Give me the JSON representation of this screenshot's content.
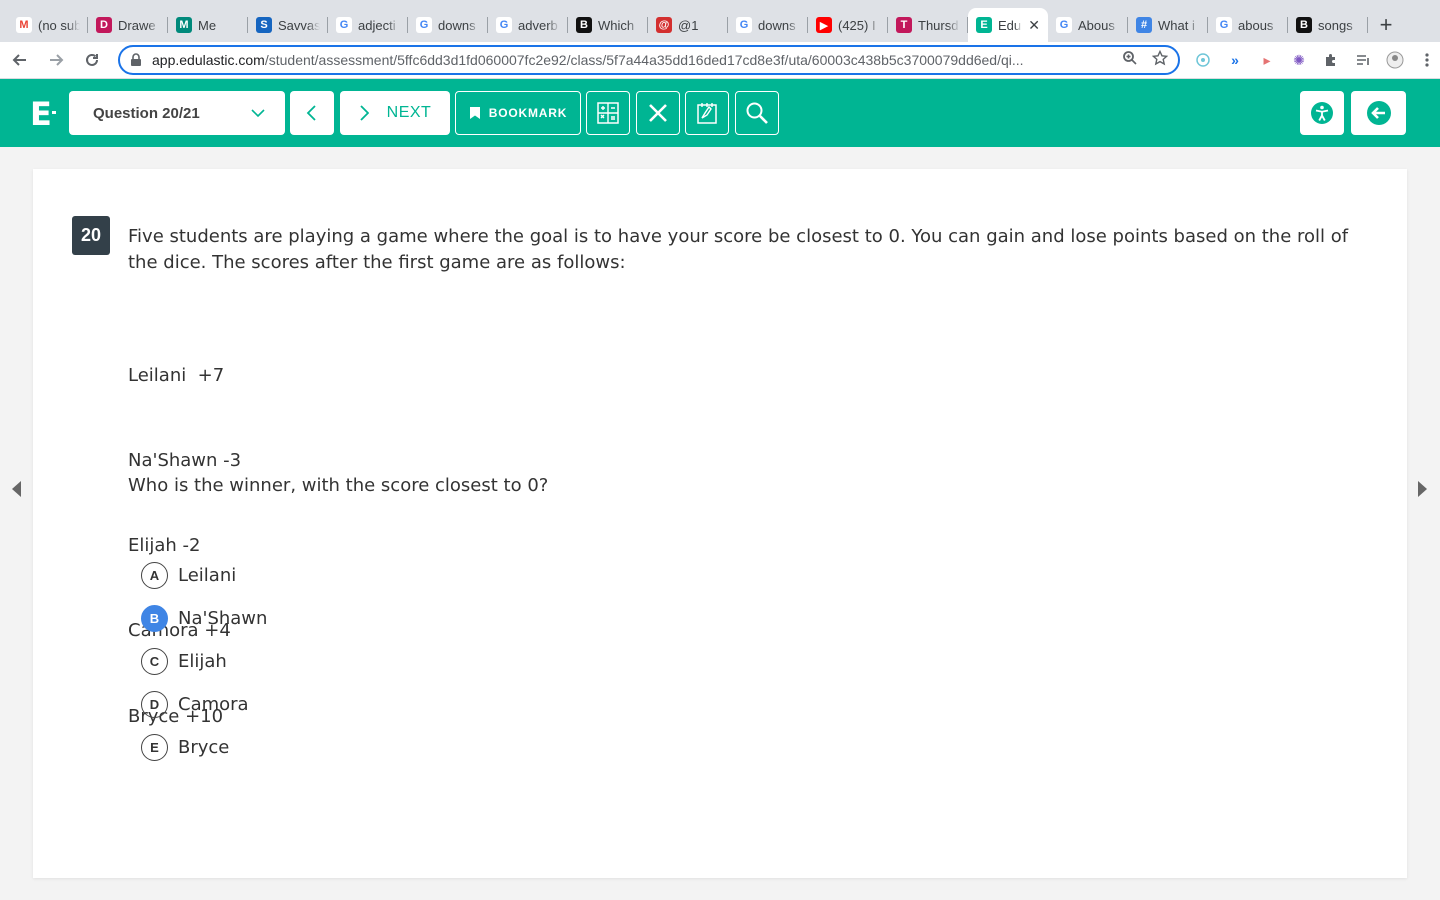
{
  "browser": {
    "tabs": [
      {
        "title": "(no sub",
        "fav_color": "#ffffff",
        "fav_glyph": "M",
        "fav_text_color": "#ea4335"
      },
      {
        "title": "Drawe",
        "fav_color": "#c2185b",
        "fav_glyph": "D",
        "fav_text_color": "#ffffff"
      },
      {
        "title": "Me",
        "fav_color": "#00897b",
        "fav_glyph": "M",
        "fav_text_color": "#ffffff"
      },
      {
        "title": "Savvas",
        "fav_color": "#1565c0",
        "fav_glyph": "S",
        "fav_text_color": "#ffffff"
      },
      {
        "title": "adjecti",
        "fav_color": "#ffffff",
        "fav_glyph": "G",
        "fav_text_color": "#4285f4"
      },
      {
        "title": "downs",
        "fav_color": "#ffffff",
        "fav_glyph": "G",
        "fav_text_color": "#4285f4"
      },
      {
        "title": "adverb",
        "fav_color": "#ffffff",
        "fav_glyph": "G",
        "fav_text_color": "#4285f4"
      },
      {
        "title": "Which",
        "fav_color": "#111111",
        "fav_glyph": "B",
        "fav_text_color": "#ffffff"
      },
      {
        "title": "@1",
        "fav_color": "#d32f2f",
        "fav_glyph": "@",
        "fav_text_color": "#ffffff"
      },
      {
        "title": "downs",
        "fav_color": "#ffffff",
        "fav_glyph": "G",
        "fav_text_color": "#4285f4"
      },
      {
        "title": "(425) I",
        "fav_color": "#ff0000",
        "fav_glyph": "▶",
        "fav_text_color": "#ffffff"
      },
      {
        "title": "Thursd",
        "fav_color": "#c2185b",
        "fav_glyph": "T",
        "fav_text_color": "#ffffff"
      },
      {
        "title": "Edu",
        "fav_color": "#00b593",
        "fav_glyph": "E",
        "fav_text_color": "#ffffff",
        "active": true
      },
      {
        "title": "Abous",
        "fav_color": "#ffffff",
        "fav_glyph": "G",
        "fav_text_color": "#4285f4"
      },
      {
        "title": "What i",
        "fav_color": "#3f85e5",
        "fav_glyph": "#",
        "fav_text_color": "#ffffff"
      },
      {
        "title": "abous",
        "fav_color": "#ffffff",
        "fav_glyph": "G",
        "fav_text_color": "#4285f4"
      },
      {
        "title": "songs",
        "fav_color": "#111111",
        "fav_glyph": "B",
        "fav_text_color": "#ffffff"
      }
    ],
    "new_tab_glyph": "+",
    "url_host": "app.edulastic.com",
    "url_path": "/student/assessment/5ffc6dd3d1fd060007fc2e92/class/5f7a44a35dd16ded17cd8e3f/uta/60003c438b5c3700079dd6ed/qi..."
  },
  "header": {
    "logo": "E",
    "question_select": "Question 20/21",
    "next_label": "NEXT",
    "bookmark_label": "BOOKMARK"
  },
  "question": {
    "number": "20",
    "stem": "Five students are playing a game where the goal is to have your score be closest to 0.  You can gain and lose points based on the roll of the dice. The scores after the first game are as follows:",
    "scores": [
      "Leilani  +7",
      "Na'Shawn -3",
      "Elijah -2",
      "Camora +4",
      "Bryce +10"
    ],
    "prompt": "Who is the winner, with the score closest to 0?",
    "choices": [
      {
        "letter": "A",
        "label": "Leilani",
        "selected": false
      },
      {
        "letter": "B",
        "label": "Na'Shawn",
        "selected": true
      },
      {
        "letter": "C",
        "label": "Elijah",
        "selected": false
      },
      {
        "letter": "D",
        "label": "Camora",
        "selected": false
      },
      {
        "letter": "E",
        "label": "Bryce",
        "selected": false
      }
    ]
  },
  "colors": {
    "brand": "#00b593",
    "selected": "#3f85e5",
    "question_badge": "#334049"
  }
}
